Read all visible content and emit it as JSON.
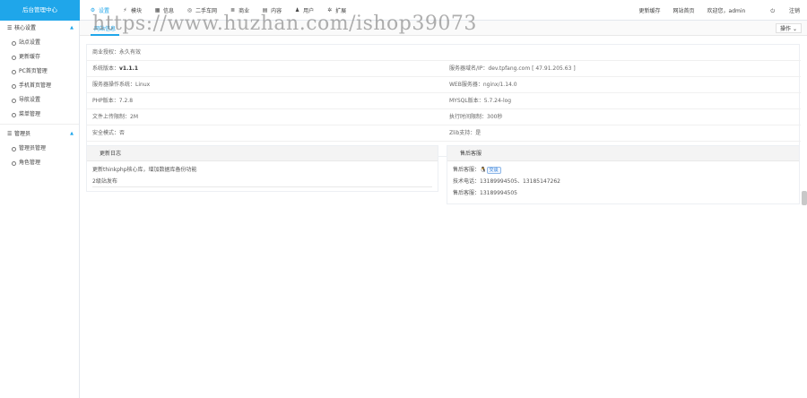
{
  "brand": "后台管理中心",
  "nav": [
    {
      "label": "设置",
      "icon": "gear-icon",
      "glyph": "⚙"
    },
    {
      "label": "模块",
      "icon": "bolt-icon",
      "glyph": "⚡"
    },
    {
      "label": "信息",
      "icon": "grid-icon",
      "glyph": "▦"
    },
    {
      "label": "二手车网",
      "icon": "circle-icon",
      "glyph": "◎"
    },
    {
      "label": "商业",
      "icon": "list-icon",
      "glyph": "≣"
    },
    {
      "label": "内容",
      "icon": "doc-icon",
      "glyph": "▤"
    },
    {
      "label": "用户",
      "icon": "user-icon",
      "glyph": "♟"
    },
    {
      "label": "扩展",
      "icon": "puzzle-icon",
      "glyph": "✲"
    }
  ],
  "right_links": {
    "cache": "更新缓存",
    "home": "网站首页",
    "welcome": "欢迎您，admin",
    "logout": "注销"
  },
  "sidebar": {
    "group1": {
      "label": "核心设置",
      "items": [
        "站点设置",
        "更新缓存",
        "PC首页管理",
        "手机首页管理",
        "导航设置",
        "菜单管理"
      ]
    },
    "group2": {
      "label": "管理员",
      "items": [
        "管理员管理",
        "角色管理"
      ]
    }
  },
  "tab": {
    "label": "网站信息"
  },
  "ops": "操作",
  "watermark": "https://www.huzhan.com/ishop39073",
  "info": {
    "license": "商业授权：永久有效",
    "version_label": "系统版本：",
    "version_value": "v1.1.1",
    "domain": "服务器域名/IP：dev.tpfang.com [ 47.91.205.63 ]",
    "os": "服务器操作系统：Linux",
    "web": "WEB服务器：nginx/1.14.0",
    "php": "PHP版本：7.2.8",
    "mysql": "MYSQL版本：5.7.24-log",
    "upload": "文件上传限制：2M",
    "exec": "执行时间限制：300秒",
    "safe": "安全模式：否",
    "zlib": "Zlib支持：是"
  },
  "update_log": {
    "title": "更新日志",
    "lines": [
      "更新thinkphp核心库，增加数据库备份功能",
      "2级站发布"
    ]
  },
  "support": {
    "title": "售后客服",
    "qq_label": "售后客服：",
    "qq_tag": "交谈",
    "tech": "技术电话：13189994505、13185147262",
    "hotline": "售后客服：13189994505"
  }
}
